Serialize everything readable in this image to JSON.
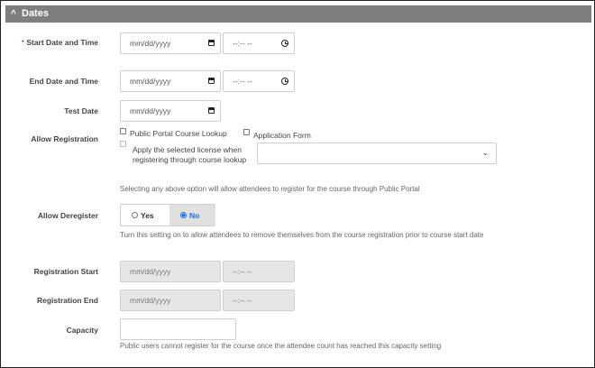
{
  "section": {
    "title": "Dates",
    "collapse_icon": "chevron-up-icon"
  },
  "start": {
    "label": "Start Date and Time",
    "required_mark": "*",
    "date_placeholder": "mm/dd/yyyy",
    "time_placeholder": "--:-- --"
  },
  "end": {
    "label": "End Date and Time",
    "date_placeholder": "mm/dd/yyyy",
    "time_placeholder": "--:-- --"
  },
  "test": {
    "label": "Test Date",
    "date_placeholder": "mm/dd/yyyy"
  },
  "registration": {
    "label": "Allow Registration",
    "option1": "Public Portal Course Lookup",
    "option2": "Application Form",
    "license_text": "Apply the selected license when registering through course lookup",
    "help": "Selecting any above option will allow attendees to register for the course through Public Portal"
  },
  "deregister": {
    "label": "Allow Deregister",
    "yes": "Yes",
    "no": "No",
    "selected": "No",
    "help": "Turn this setting on to allow attendees to remove themselves from the course registration prior to course start date"
  },
  "reg_start": {
    "label": "Registration Start",
    "date_placeholder": "mm/dd/yyyy",
    "time_placeholder": "--:-- --"
  },
  "reg_end": {
    "label": "Registration End",
    "date_placeholder": "mm/dd/yyyy",
    "time_placeholder": "--:-- --"
  },
  "capacity": {
    "label": "Capacity",
    "value": "",
    "help": "Public users cannot register for the course once the attendee count has reached this capacity setting"
  },
  "colors": {
    "header_bg": "#7f7f7f",
    "accent": "#1a73e8",
    "disabled_bg": "#e6e6e6"
  },
  "icons": {
    "calendar": "calendar-icon",
    "clock": "clock-icon",
    "dropdown": "chevron-down-icon"
  }
}
